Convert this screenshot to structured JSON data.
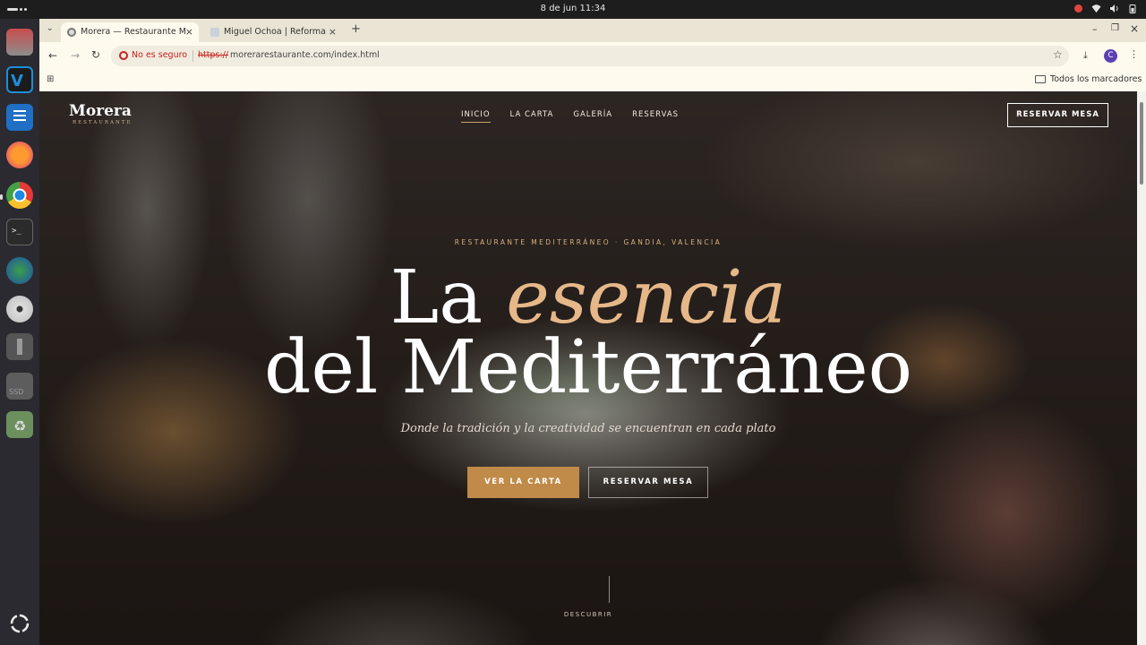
{
  "os": {
    "clock": "8 de jun  11:34"
  },
  "browser": {
    "tabs": [
      {
        "title": "Morera — Restaurante M"
      },
      {
        "title": "Miguel Ochoa | Reforma"
      }
    ],
    "security_label": "No es seguro",
    "url_scheme": "https://",
    "url_rest": "morerarestaurante.com/index.html",
    "profile_initial": "C",
    "bookmarks_label": "Todos los marcadores"
  },
  "site": {
    "logo_name": "Morera",
    "logo_sub": "RESTAURANTE",
    "nav": [
      "INICIO",
      "LA CARTA",
      "GALERÍA",
      "RESERVAS"
    ],
    "header_button": "RESERVAR MESA",
    "eyebrow": "RESTAURANTE MEDITERRÁNEO · GANDIA, VALENCIA",
    "headline_1": "La ",
    "headline_em": "esencia",
    "headline_2": "del Mediterráneo",
    "lead": "Donde la tradición y la creatividad se encuentran en cada plato",
    "cta_primary": "VER LA CARTA",
    "cta_secondary": "RESERVAR MESA",
    "discover": "DESCUBRIR"
  },
  "colors": {
    "accent": "#c08a48",
    "headline_em": "#e6b889",
    "eyebrow": "#d7b07d",
    "security_red": "#c5221f"
  }
}
